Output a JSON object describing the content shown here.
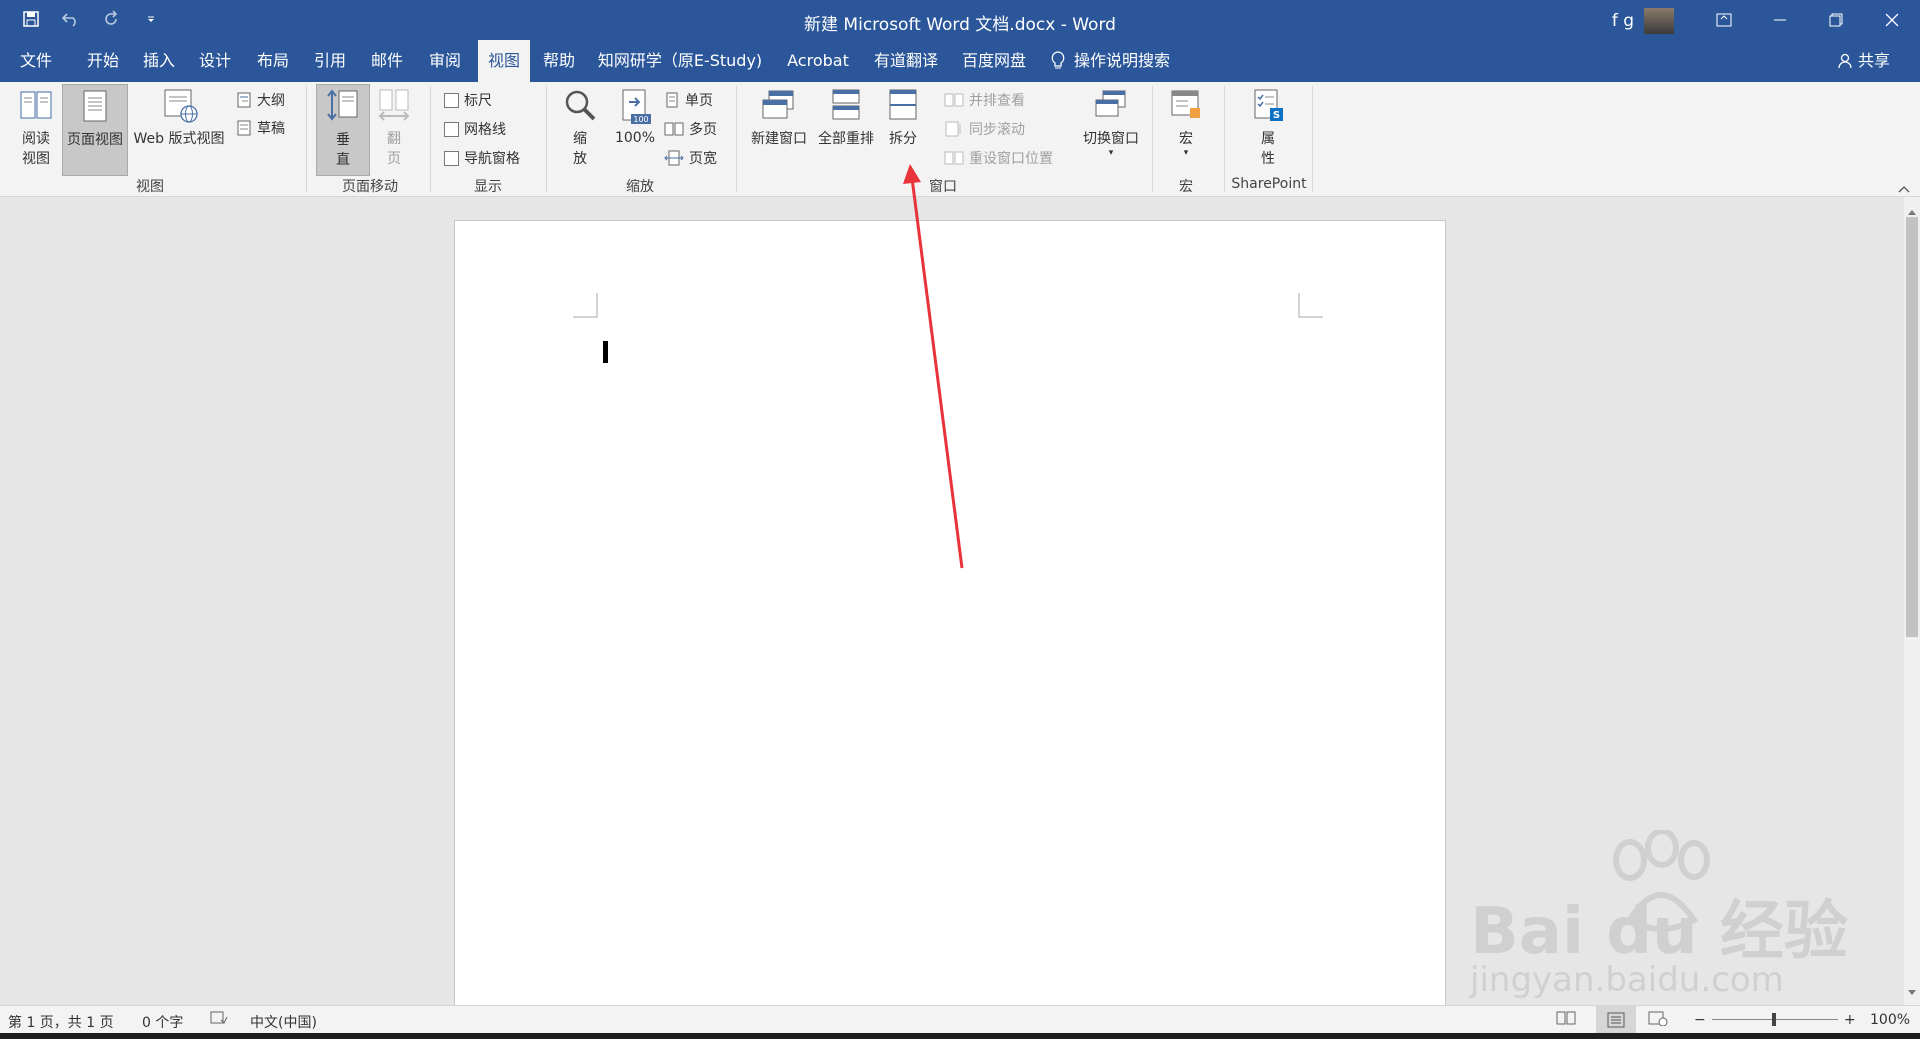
{
  "window": {
    "title": "新建 Microsoft Word 文档.docx  -  Word",
    "user_initials": "f g"
  },
  "tabs": [
    "文件",
    "开始",
    "插入",
    "设计",
    "布局",
    "引用",
    "邮件",
    "审阅",
    "视图",
    "帮助",
    "知网研学（原E-Study)",
    "Acrobat",
    "有道翻译",
    "百度网盘",
    "操作说明搜索"
  ],
  "share_label": "共享",
  "ribbon": {
    "views": {
      "read_mode_l1": "阅读",
      "read_mode_l2": "视图",
      "print_layout": "页面视图",
      "web_layout": "Web 版式视图",
      "outline": "大纲",
      "draft": "草稿",
      "group_label": "视图"
    },
    "page_movement": {
      "vertical_l1": "垂",
      "vertical_l2": "直",
      "side_l1": "翻",
      "side_l2": "页",
      "group_label": "页面移动"
    },
    "show": {
      "ruler": "标尺",
      "gridlines": "网格线",
      "nav_pane": "导航窗格",
      "group_label": "显示"
    },
    "zoom": {
      "zoom_l1": "缩",
      "zoom_l2": "放",
      "hundred": "100%",
      "one_page": "单页",
      "multi_page": "多页",
      "page_width": "页宽",
      "group_label": "缩放"
    },
    "window": {
      "new_window": "新建窗口",
      "arrange_all": "全部重排",
      "split": "拆分",
      "side_by_side": "并排查看",
      "sync_scroll": "同步滚动",
      "reset_pos": "重设窗口位置",
      "switch_windows": "切换窗口",
      "group_label": "窗口"
    },
    "macros": {
      "macros": "宏",
      "group_label": "宏"
    },
    "sharepoint": {
      "properties_l1": "属",
      "properties_l2": "性",
      "group_label": "SharePoint"
    }
  },
  "status": {
    "page": "第 1 页，共 1 页",
    "words": "0 个字",
    "language": "中文(中国)",
    "zoom": "100%"
  },
  "watermark": {
    "brand": "Bai du 经验",
    "url": "jingyan.baidu.com"
  },
  "colors": {
    "accent": "#2b579a",
    "annotation_arrow": "#e8333a"
  }
}
